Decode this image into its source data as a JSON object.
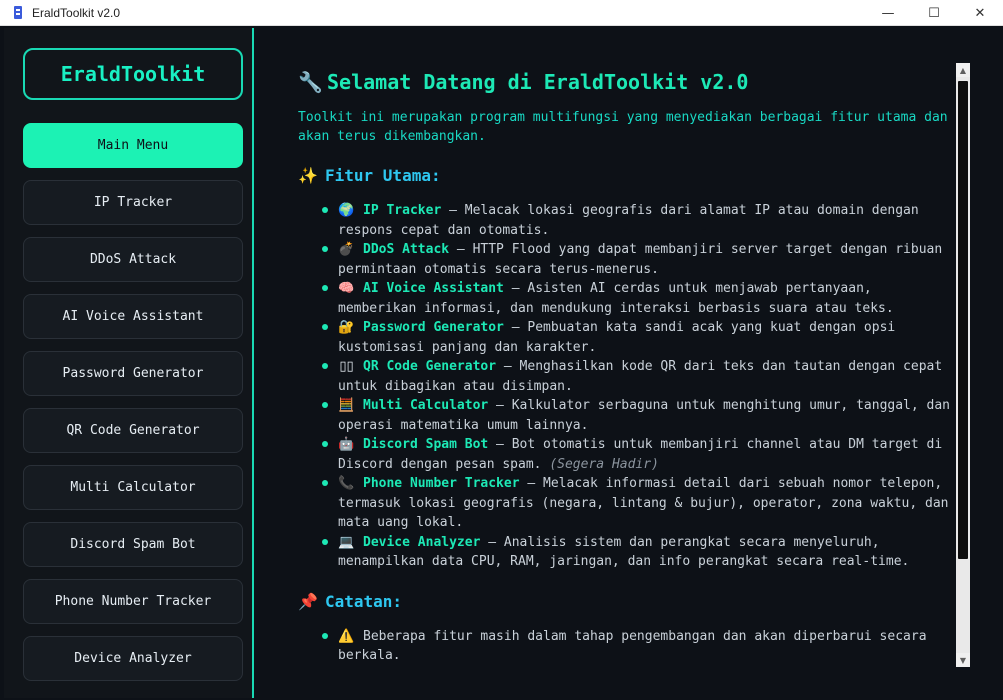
{
  "window": {
    "title": "EraldToolkit v2.0",
    "controls": {
      "minimize": "—",
      "maximize": "☐",
      "close": "✕"
    }
  },
  "sidebar": {
    "logo": "EraldToolkit",
    "items": [
      {
        "label": "Main Menu",
        "active": true
      },
      {
        "label": "IP Tracker"
      },
      {
        "label": "DDoS Attack"
      },
      {
        "label": "AI Voice Assistant"
      },
      {
        "label": "Password Generator"
      },
      {
        "label": "QR Code Generator"
      },
      {
        "label": "Multi Calculator"
      },
      {
        "label": "Discord Spam Bot"
      },
      {
        "label": "Phone Number Tracker"
      },
      {
        "label": "Device Analyzer"
      }
    ]
  },
  "content": {
    "heading_icon": "🔧",
    "heading": "Selamat Datang di EraldToolkit v2.0",
    "intro": "Toolkit ini merupakan program multifungsi yang menyediakan berbagai fitur utama dan akan terus dikembangkan.",
    "features_icon": "✨",
    "features_title": "Fitur Utama:",
    "features": [
      {
        "icon": "🌍",
        "name": "IP Tracker",
        "desc": " – Melacak lokasi geografis dari alamat IP atau domain dengan respons cepat dan otomatis."
      },
      {
        "icon": "💣",
        "name": "DDoS Attack",
        "desc": " – HTTP Flood yang dapat membanjiri server target dengan ribuan permintaan otomatis secara terus-menerus."
      },
      {
        "icon": "🧠",
        "name": "AI Voice Assistant",
        "desc": " – Asisten AI cerdas untuk menjawab pertanyaan, memberikan informasi, dan mendukung interaksi berbasis suara atau teks."
      },
      {
        "icon": "🔐",
        "name": "Password Generator",
        "desc": " – Pembuatan kata sandi acak yang kuat dengan opsi kustomisasi panjang dan karakter."
      },
      {
        "icon": "▯▯",
        "name": "QR Code Generator",
        "desc": " – Menghasilkan kode QR dari teks dan tautan dengan cepat untuk dibagikan atau disimpan."
      },
      {
        "icon": "🧮",
        "name": "Multi Calculator",
        "desc": " – Kalkulator serbaguna untuk menghitung umur, tanggal, dan operasi matematika umum lainnya."
      },
      {
        "icon": "🤖",
        "name": "Discord Spam Bot",
        "desc": " – Bot otomatis untuk membanjiri channel atau DM target di Discord dengan pesan spam. ",
        "note": "(Segera Hadir)"
      },
      {
        "icon": "📞",
        "name": "Phone Number Tracker",
        "desc": " – Melacak informasi detail dari sebuah nomor telepon, termasuk lokasi geografis (negara, lintang & bujur), operator, zona waktu, dan mata uang lokal."
      },
      {
        "icon": "💻",
        "name": "Device Analyzer",
        "desc": " – Analisis sistem dan perangkat secara menyeluruh, menampilkan data CPU, RAM, jaringan, dan info perangkat secara real-time."
      }
    ],
    "notes_icon": "📌",
    "notes_title": "Catatan:",
    "notes": [
      {
        "icon": "⚠️",
        "text": "Beberapa fitur masih dalam tahap pengembangan dan akan diperbarui secara berkala."
      }
    ]
  },
  "colors": {
    "accent": "#1de9b6",
    "active_nav": "#1cf2b4",
    "sub_heading": "#2ec7f0",
    "background": "#0d1117"
  }
}
